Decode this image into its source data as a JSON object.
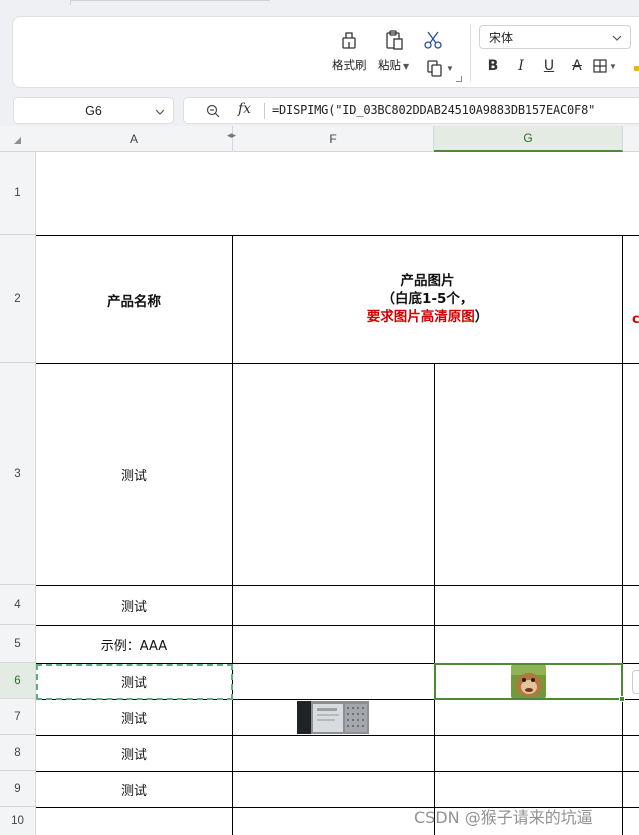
{
  "ribbon": {
    "format_painter_label": "格式刷",
    "paste_label": "粘贴",
    "font_name": "宋体",
    "bold_label": "B",
    "italic_label": "I",
    "underline_label": "U",
    "strikethrough_label": "A"
  },
  "formula_bar": {
    "cell_ref": "G6",
    "fx_label": "fx",
    "formula": "=DISPIMG(\"ID_03BC802DDAB24510A9883DB157EAC0F8\""
  },
  "columns": [
    {
      "id": "A",
      "label": "A"
    },
    {
      "id": "F",
      "label": "F"
    },
    {
      "id": "G",
      "label": "G",
      "selected": true
    }
  ],
  "rows": [
    "1",
    "2",
    "3",
    "4",
    "5",
    "6",
    "7",
    "8",
    "9",
    "10"
  ],
  "cells": {
    "header_product_name": "产品名称",
    "header_product_image_line1": "产品图片",
    "header_product_image_line2": "（白底1-5个，",
    "header_product_image_red": "要求图片高清原图",
    "header_product_image_close": "）",
    "a3": "测试",
    "a4": "测试",
    "a5": "示例：AAA",
    "a6": "测试",
    "a7": "测试",
    "a8": "测试",
    "a9": "测试",
    "h2_peek": "c"
  },
  "watermark": "CSDN @猴子请来的坑逼",
  "colors": {
    "accent_green": "#4c8a36",
    "red_text": "#d40000",
    "header_bg": "#f3f4f6"
  }
}
